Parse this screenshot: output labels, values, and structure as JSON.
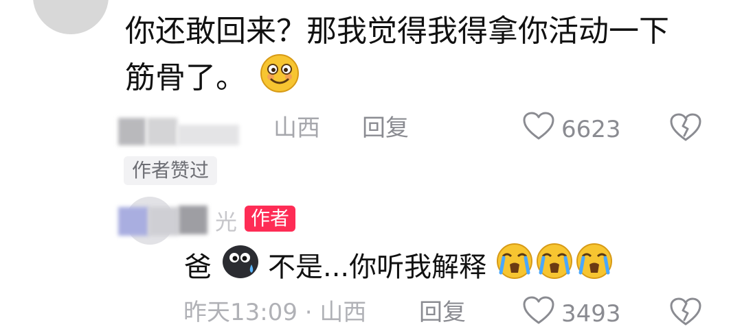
{
  "comment_top": {
    "text_line1": "你还敢回来？那我觉得我得拿你活动一下",
    "text_line2": "筋骨了。",
    "emoji": "smile-emoji",
    "location": "山西",
    "reply_label": "回复",
    "like_count": "6623",
    "author_liked_badge": "作者赞过"
  },
  "comment_reply": {
    "name_visible": "光",
    "author_badge": "作者",
    "text_part1": "爸",
    "text_part2": "不是...你听我解释",
    "emojis": [
      "black-blob-emoji",
      "crying-emoji",
      "crying-emoji",
      "crying-emoji"
    ],
    "time": "昨天13:09",
    "separator": "·",
    "location": "山西",
    "reply_label": "回复",
    "like_count": "3493"
  },
  "colors": {
    "text": "#111111",
    "meta": "#8a8b91",
    "author_badge": "#fe2c55",
    "badge_bg": "#f2f2f4"
  }
}
